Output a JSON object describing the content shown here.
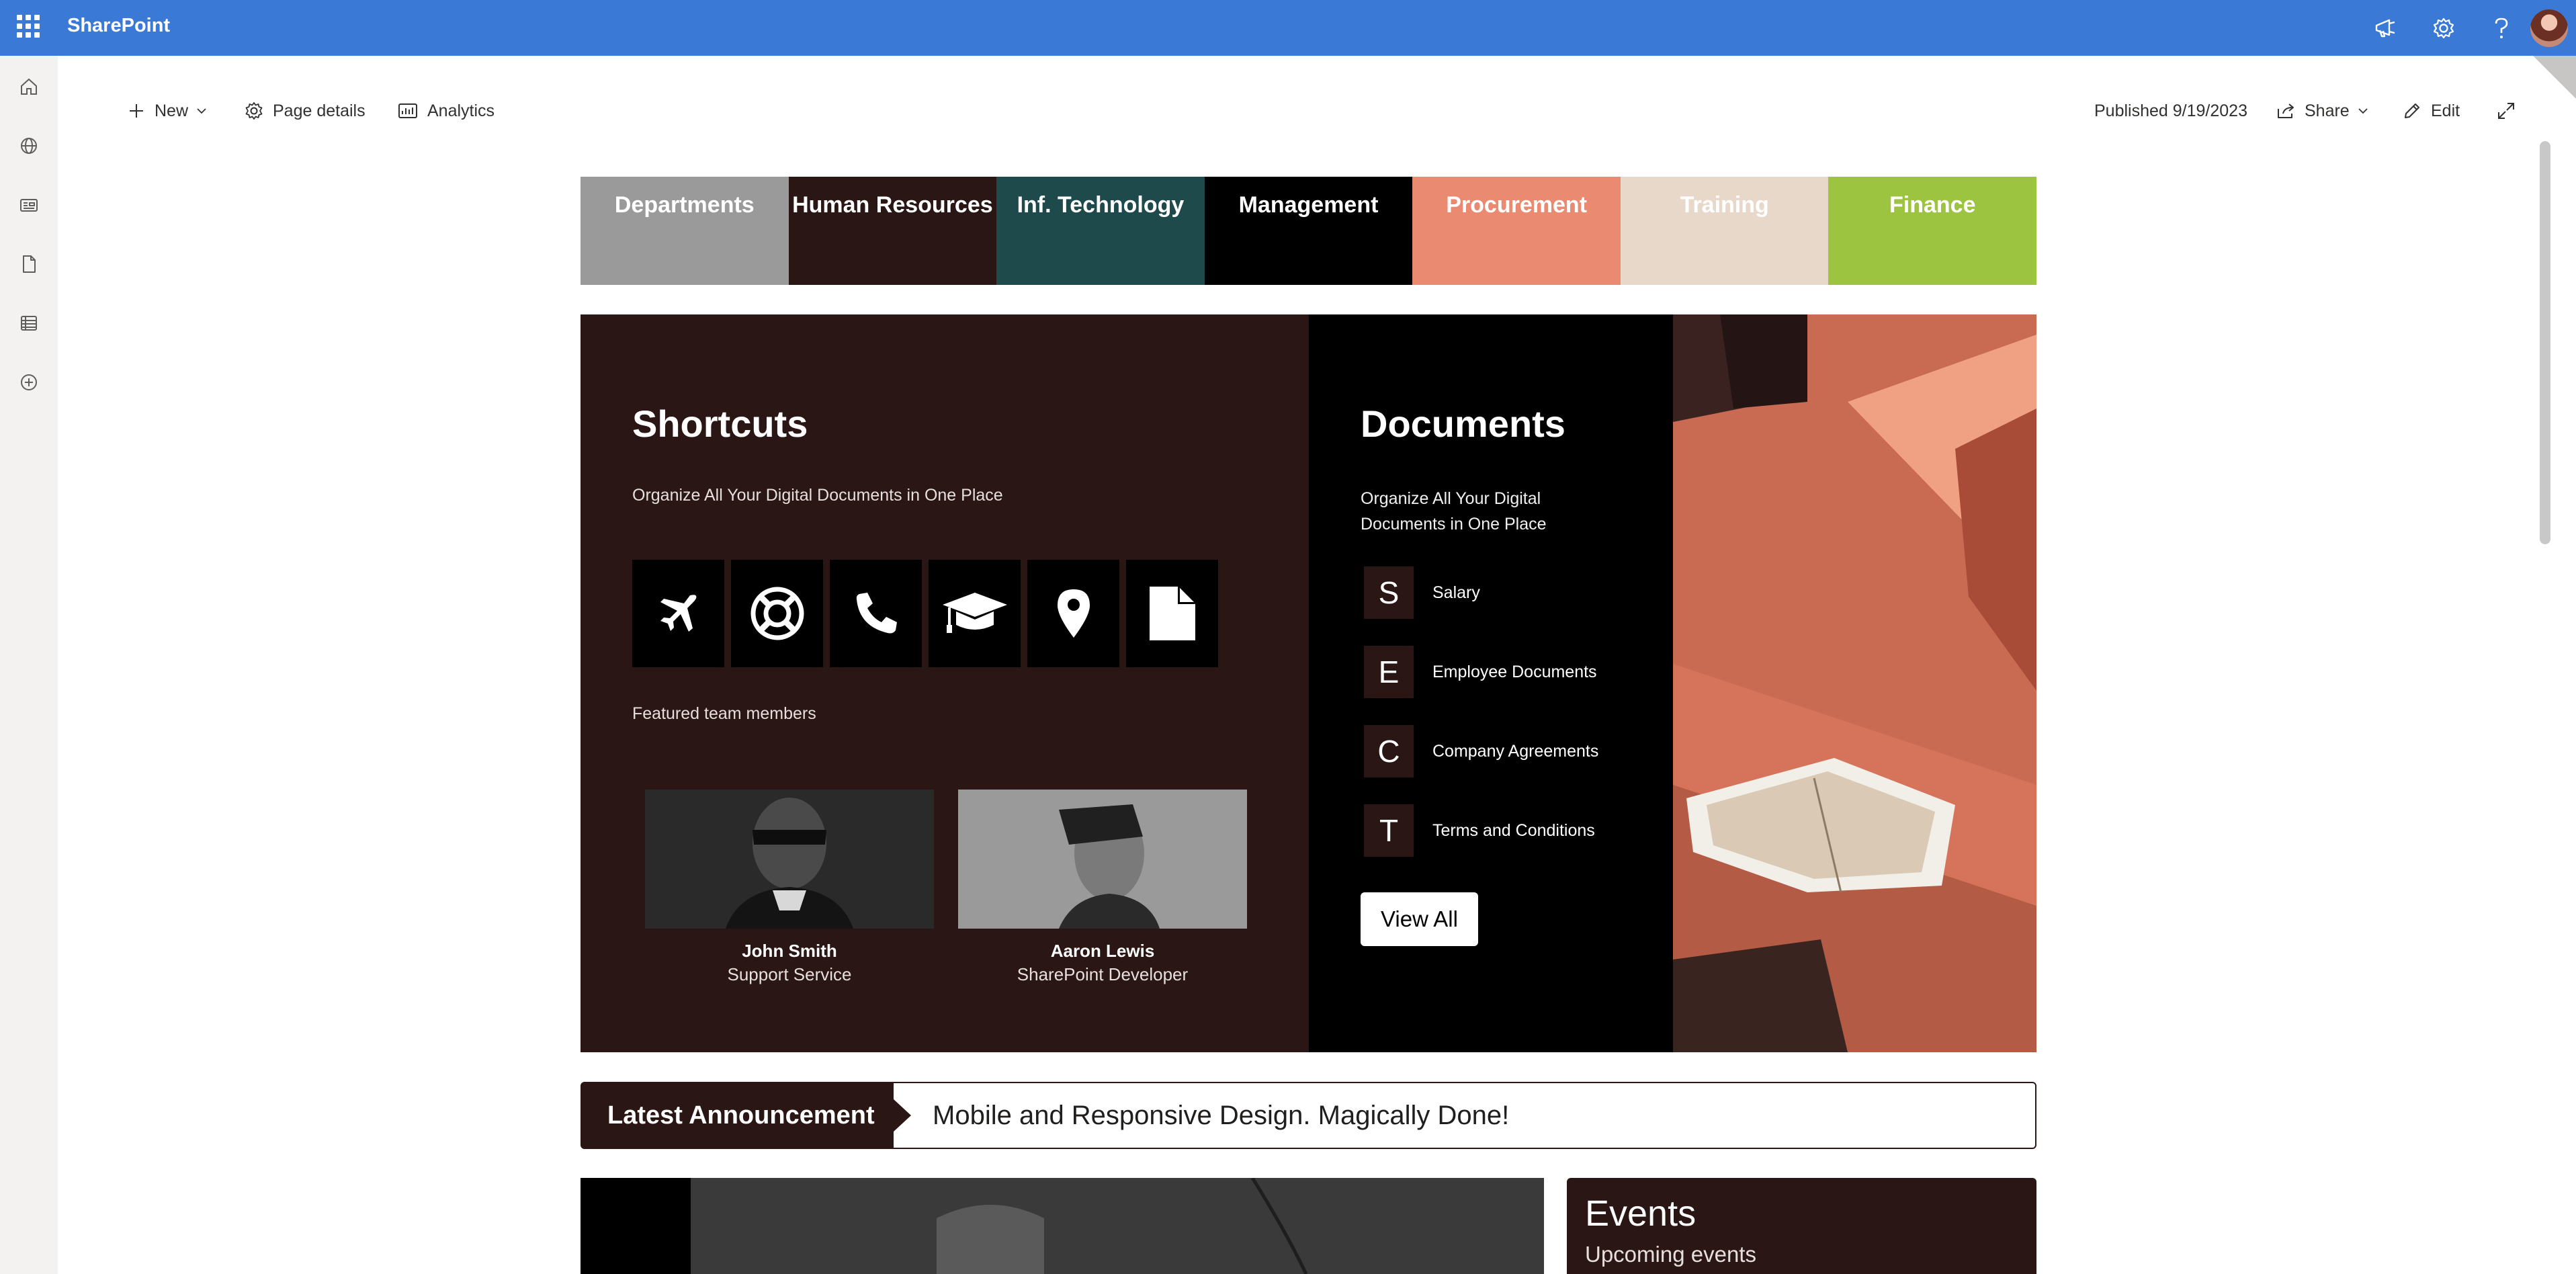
{
  "suite": {
    "app_title": "SharePoint"
  },
  "command_bar": {
    "new_label": "New",
    "page_details_label": "Page details",
    "analytics_label": "Analytics",
    "published_label": "Published 9/19/2023",
    "share_label": "Share",
    "edit_label": "Edit"
  },
  "tiles": [
    {
      "label": "Departments",
      "color": "#9a9a9a",
      "text_color": "#ffffff"
    },
    {
      "label": "Human Resources",
      "color": "#2a1614",
      "text_color": "#ffffff"
    },
    {
      "label": "Inf. Technology",
      "color": "#1e4a4c",
      "text_color": "#ffffff"
    },
    {
      "label": "Management",
      "color": "#000000",
      "text_color": "#ffffff"
    },
    {
      "label": "Procurement",
      "color": "#ea8a70",
      "text_color": "#ffffff"
    },
    {
      "label": "Training",
      "color": "#e8d8ca",
      "text_color": "#ffffff"
    },
    {
      "label": "Finance",
      "color": "#9cc440",
      "text_color": "#ffffff"
    }
  ],
  "shortcuts": {
    "title": "Shortcuts",
    "subtitle": "Organize All Your Digital Documents in One Place",
    "icons": [
      "airplane-icon",
      "lifebuoy-icon",
      "phone-icon",
      "graduation-cap-icon",
      "map-pin-icon",
      "document-icon"
    ],
    "featured_label": "Featured team members",
    "members": [
      {
        "name": "John Smith",
        "role": "Support Service"
      },
      {
        "name": "Aaron Lewis",
        "role": "SharePoint Developer"
      }
    ]
  },
  "documents": {
    "title": "Documents",
    "subtitle": "Organize All Your Digital Documents in One Place",
    "items": [
      {
        "letter": "S",
        "label": "Salary"
      },
      {
        "letter": "E",
        "label": "Employee Documents"
      },
      {
        "letter": "C",
        "label": "Company Agreements"
      },
      {
        "letter": "T",
        "label": "Terms and Conditions"
      }
    ],
    "view_all_label": "View All"
  },
  "announcement": {
    "label": "Latest Announcement",
    "text": "Mobile and Responsive Design. Magically Done!"
  },
  "events": {
    "title": "Events",
    "subtitle": "Upcoming events"
  },
  "colors": {
    "suite_bar": "#3b79d6",
    "brand_dark": "#2a1614"
  }
}
